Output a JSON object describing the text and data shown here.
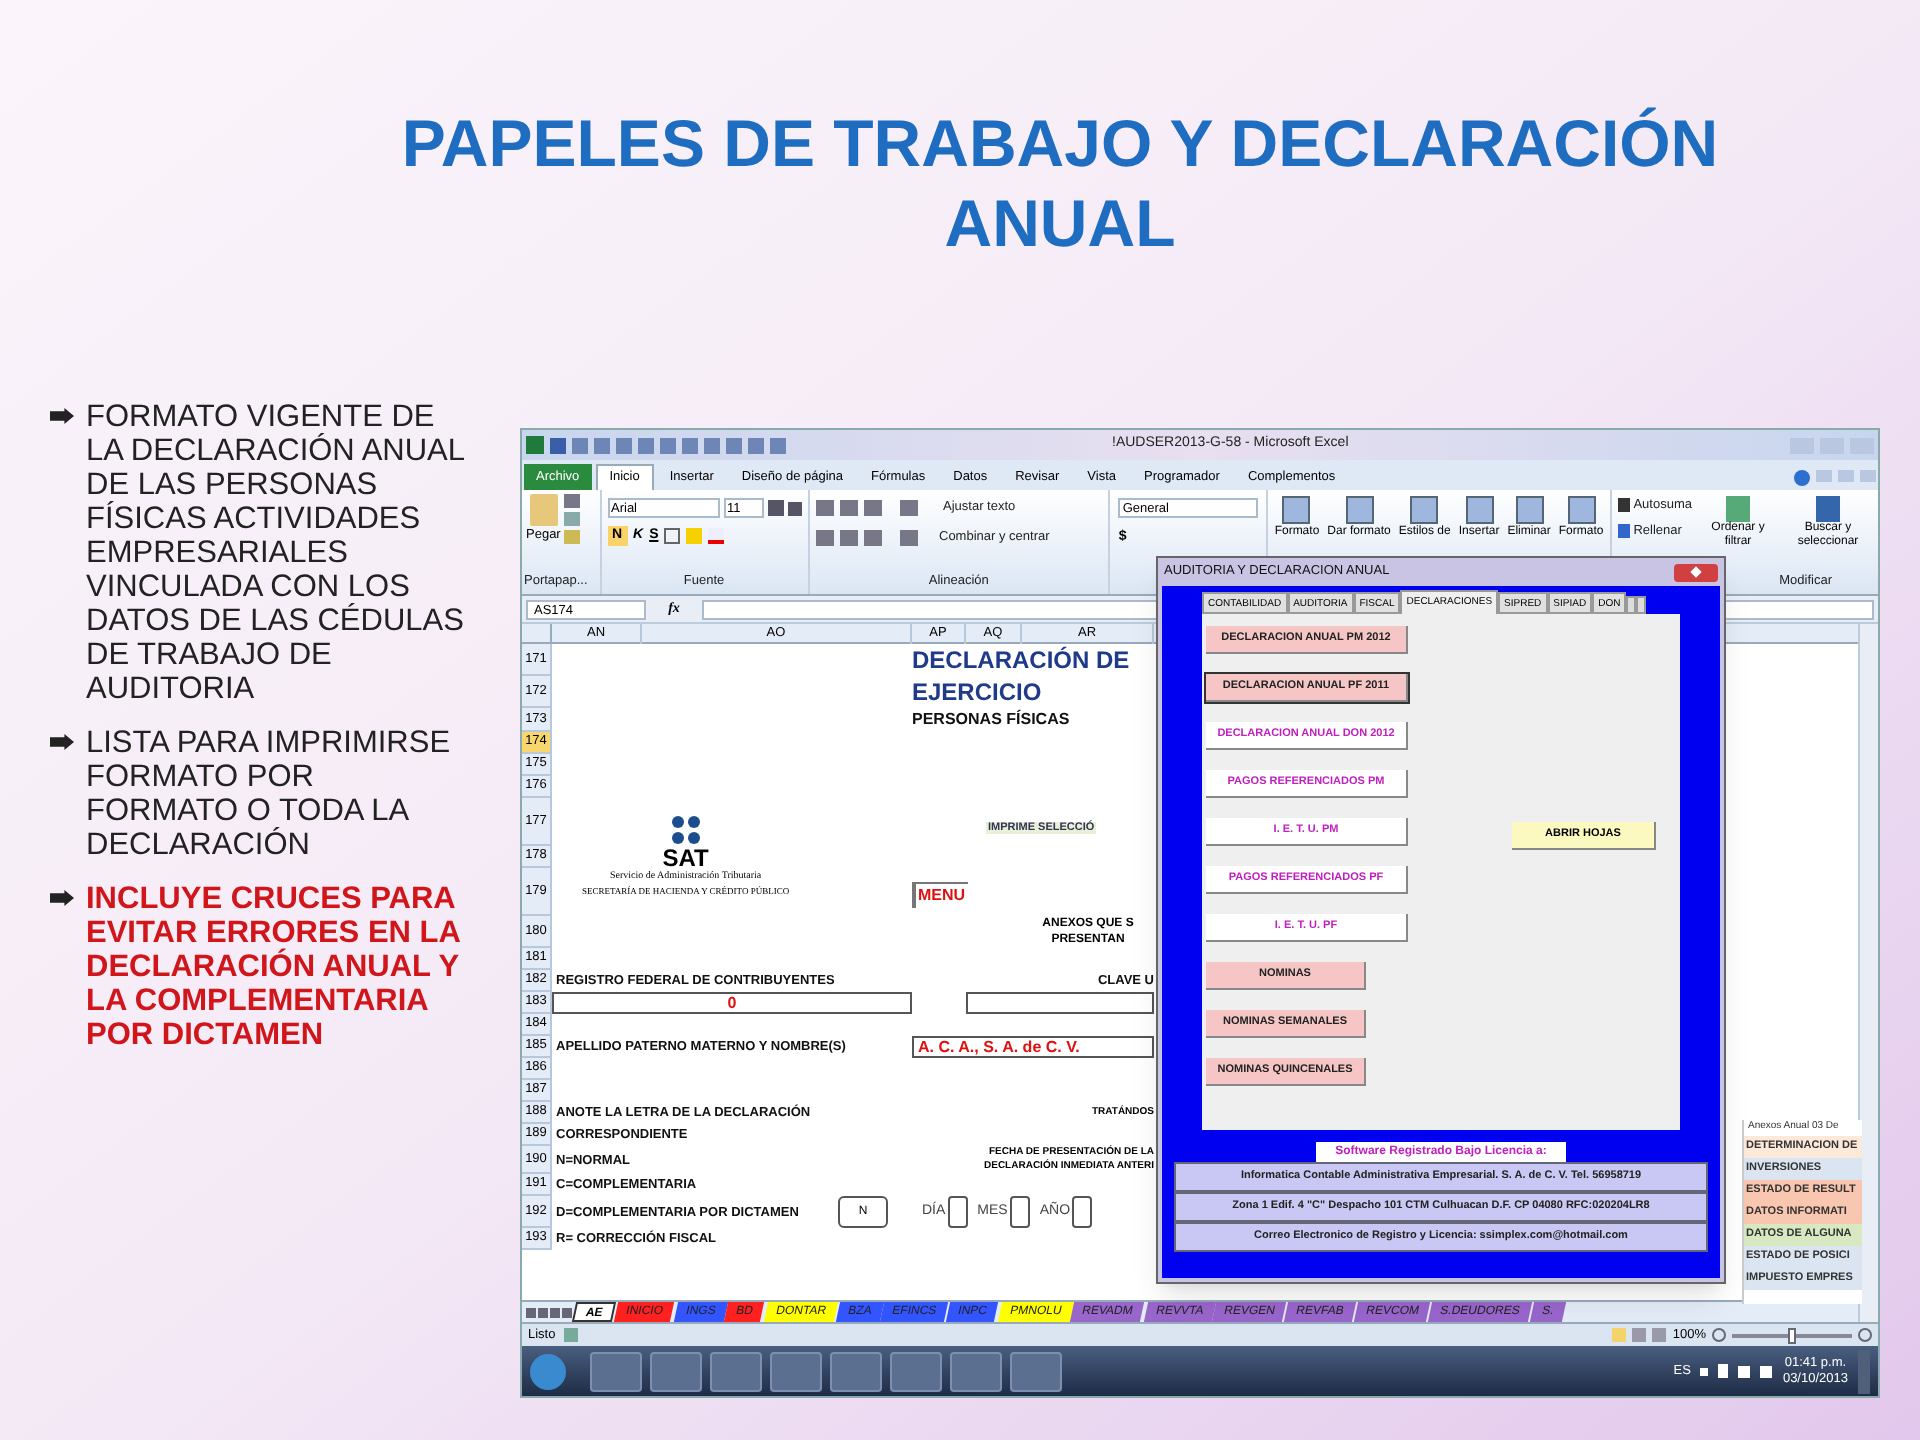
{
  "title": "PAPELES DE TRABAJO Y DECLARACIÓN ANUAL",
  "bullets": [
    {
      "text": "FORMATO VIGENTE DE LA DECLARACIÓN ANUAL DE LAS PERSONAS FÍSICAS ACTIVIDADES EMPRESARIALES VINCULADA CON LOS DATOS DE LAS CÉDULAS DE TRABAJO DE AUDITORIA",
      "emphasis": false
    },
    {
      "text": "LISTA PARA IMPRIMIRSE FORMATO POR FORMATO O TODA LA DECLARACIÓN",
      "emphasis": false
    },
    {
      "text": "INCLUYE CRUCES PARA EVITAR ERRORES EN LA DECLARACIÓN ANUAL Y LA COMPLEMENTARIA POR DICTAMEN",
      "emphasis": true
    }
  ],
  "excel": {
    "window_title": "!AUDSER2013-G-58 - Microsoft Excel",
    "ribbon_tabs": [
      {
        "label": "Archivo",
        "kind": "file",
        "selected": false
      },
      {
        "label": "Inicio",
        "kind": "tab",
        "selected": true
      },
      {
        "label": "Insertar",
        "kind": "tab",
        "selected": false
      },
      {
        "label": "Diseño de página",
        "kind": "tab",
        "selected": false
      },
      {
        "label": "Fórmulas",
        "kind": "tab",
        "selected": false
      },
      {
        "label": "Datos",
        "kind": "tab",
        "selected": false
      },
      {
        "label": "Revisar",
        "kind": "tab",
        "selected": false
      },
      {
        "label": "Vista",
        "kind": "tab",
        "selected": false
      },
      {
        "label": "Programador",
        "kind": "tab",
        "selected": false
      },
      {
        "label": "Complementos",
        "kind": "tab",
        "selected": false
      }
    ],
    "ribbon": {
      "paste": "Pegar",
      "clipboard_group": "Portapap...",
      "font_name": "Arial",
      "font_size": "11",
      "bold": "N",
      "italic": "K",
      "underline": "S",
      "font_group": "Fuente",
      "wrap_text": "Ajustar texto",
      "merge_center": "Combinar y centrar",
      "alignment_group": "Alineación",
      "number_format": "General",
      "currency": "$",
      "style_buttons": [
        "Formato",
        "Dar formato",
        "Estilos de"
      ],
      "cell_buttons": [
        "Insertar",
        "Eliminar",
        "Formato"
      ],
      "autosum": "Autosuma",
      "fill": "Rellenar",
      "sort": "Ordenar y filtrar",
      "find": "Buscar y seleccionar",
      "editing_group": "Modificar"
    },
    "name_box": "AS174",
    "formula_label": "fx",
    "columns": [
      "AN",
      "AO",
      "AP",
      "AQ",
      "AR"
    ],
    "rows": [
      {
        "number": "171",
        "selected": false,
        "right": {
          "kind": "title",
          "text": "DECLARACIÓN DE"
        }
      },
      {
        "number": "172",
        "selected": false,
        "right": {
          "kind": "title",
          "text": "EJERCICIO"
        }
      },
      {
        "number": "173",
        "selected": false,
        "right": {
          "kind": "subtitle",
          "text": "PERSONAS FÍSICAS"
        }
      },
      {
        "number": "174",
        "selected": true
      },
      {
        "number": "175",
        "selected": false
      },
      {
        "number": "176",
        "selected": false
      },
      {
        "number": "177",
        "selected": false,
        "far": {
          "kind": "note",
          "text": "IMPRIME SELECCIÓ"
        }
      },
      {
        "number": "178",
        "selected": false,
        "middle": {
          "kind": "logo",
          "text": "SAT",
          "lines": [
            "Servicio de Administración Tributaria",
            "SECRETARÍA DE HACIENDA Y CRÉDITO PÚBLICO"
          ]
        }
      },
      {
        "number": "179",
        "selected": false,
        "right": {
          "kind": "menu",
          "text": "MENU"
        }
      },
      {
        "number": "180",
        "selected": false,
        "far": {
          "kind": "label",
          "lines": [
            "ANEXOS QUE S",
            "PRESENTAN"
          ]
        }
      },
      {
        "number": "181",
        "selected": false
      },
      {
        "number": "182",
        "selected": false,
        "left": {
          "kind": "label",
          "text": "REGISTRO FEDERAL DE CONTRIBUYENTES"
        },
        "far": {
          "kind": "label",
          "text": "CLAVE U"
        }
      },
      {
        "number": "183",
        "selected": false,
        "left": {
          "kind": "input",
          "text": "0"
        },
        "far": {
          "kind": "input"
        }
      },
      {
        "number": "184",
        "selected": false
      },
      {
        "number": "185",
        "selected": false,
        "left": {
          "kind": "label",
          "text": "APELLIDO PATERNO MATERNO Y NOMBRE(S)"
        },
        "right": {
          "kind": "input",
          "text": "A. C. A.,  S. A. de C. V."
        }
      },
      {
        "number": "186",
        "selected": false
      },
      {
        "number": "187",
        "selected": false
      },
      {
        "number": "188",
        "selected": false,
        "left": {
          "kind": "label",
          "text": "ANOTE LA LETRA DE LA DECLARACIÓN"
        },
        "far": {
          "kind": "small",
          "text": "TRATÁNDOS"
        }
      },
      {
        "number": "189",
        "selected": false,
        "left": {
          "kind": "label",
          "text": "CORRESPONDIENTE"
        }
      },
      {
        "number": "190",
        "selected": false,
        "left": {
          "kind": "label",
          "text": "N=NORMAL"
        },
        "right": {
          "kind": "small",
          "lines": [
            "FECHA DE PRESENTACIÓN DE LA",
            "DECLARACIÓN INMEDIATA ANTERI"
          ]
        }
      },
      {
        "number": "191",
        "selected": false,
        "left": {
          "kind": "label",
          "text": "C=COMPLEMENTARIA"
        }
      },
      {
        "number": "192",
        "selected": false,
        "left": {
          "kind": "label",
          "text": "D=COMPLEMENTARIA POR DICTAMEN"
        },
        "middle": {
          "kind": "letter",
          "text": "N"
        },
        "right": {
          "kind": "date",
          "lines": [
            "DÍA",
            "MES",
            "AÑO"
          ]
        }
      },
      {
        "number": "193",
        "selected": false,
        "left": {
          "kind": "label",
          "text": "R= CORRECCIÓN FISCAL"
        }
      }
    ],
    "sheet_tabs": [
      {
        "label": "AE",
        "selected": true,
        "color": "#ffffff"
      },
      {
        "label": "INICIO",
        "selected": false,
        "color": "#ff2020"
      },
      {
        "label": "INGS",
        "selected": false,
        "color": "#3355ff"
      },
      {
        "label": "BD",
        "selected": false,
        "color": "#ff2020"
      },
      {
        "label": "DONTAR",
        "selected": false,
        "color": "#ffff00"
      },
      {
        "label": "BZA",
        "selected": false,
        "color": "#3355ff"
      },
      {
        "label": "EFINCS",
        "selected": false,
        "color": "#3355ff"
      },
      {
        "label": "INPC",
        "selected": false,
        "color": "#3355ff"
      },
      {
        "label": "PMNOLU",
        "selected": false,
        "color": "#ffff00"
      },
      {
        "label": "REVADM",
        "selected": false,
        "color": "#9966cc"
      },
      {
        "label": "REVVTA",
        "selected": false,
        "color": "#9966cc"
      },
      {
        "label": "REVGEN",
        "selected": false,
        "color": "#9966cc"
      },
      {
        "label": "REVFAB",
        "selected": false,
        "color": "#9966cc"
      },
      {
        "label": "REVCOM",
        "selected": false,
        "color": "#9966cc"
      },
      {
        "label": "S.DEUDORES",
        "selected": false,
        "color": "#9966cc"
      },
      {
        "label": "S.",
        "selected": false,
        "color": "#9966cc"
      }
    ],
    "status": "Listo",
    "zoom": "100%",
    "zoom_slider": {
      "level": 0.5
    },
    "annex_panel": {
      "title": "Anexos Anual 03 De",
      "items": [
        {
          "label": "DETERMINACION DE",
          "color": "#fde9d9"
        },
        {
          "label": "INVERSIONES",
          "color": "#dbe5f1"
        },
        {
          "label": "ESTADO DE RESULT",
          "color": "#f9c7b0"
        },
        {
          "label": "DATOS INFORMATI",
          "color": "#f9c7b0"
        },
        {
          "label": "DATOS DE ALGUNA",
          "color": "#d8e8c0"
        },
        {
          "label": "ESTADO DE POSICI",
          "color": "#dbe5f1"
        },
        {
          "label": "IMPUESTO EMPRES",
          "color": "#dbe5f1"
        }
      ]
    },
    "dialog": {
      "title": "AUDITORIA Y DECLARACION ANUAL",
      "tabs": [
        {
          "label": "CONTABILIDAD",
          "selected": false
        },
        {
          "label": "AUDITORIA",
          "selected": false
        },
        {
          "label": "FISCAL",
          "selected": false
        },
        {
          "label": "DECLARACIONES",
          "selected": true
        },
        {
          "label": "SIPRED",
          "selected": false
        },
        {
          "label": "SIPIAD",
          "selected": false
        },
        {
          "label": "DON",
          "selected": false
        }
      ],
      "buttons": [
        {
          "label": "DECLARACION ANUAL PM 2012",
          "kind": "highlighted",
          "focused": false
        },
        {
          "label": "DECLARACION ANUAL PF 2011",
          "kind": "highlighted",
          "focused": true
        },
        {
          "label": "DECLARACION ANUAL DON 2012",
          "kind": "plain",
          "focused": false
        },
        {
          "label": "PAGOS REFERENCIADOS PM",
          "kind": "plain",
          "focused": false
        },
        {
          "label": "I. E. T. U.   PM",
          "kind": "plain",
          "focused": false
        },
        {
          "label": "PAGOS REFERENCIADOS PF",
          "kind": "plain",
          "focused": false
        },
        {
          "label": "I. E. T. U.  PF",
          "kind": "plain",
          "focused": false
        }
      ],
      "payroll_buttons": [
        {
          "label": "NOMINAS",
          "kind": "highlighted",
          "focused": false
        },
        {
          "label": "NOMINAS SEMANALES",
          "kind": "highlighted",
          "focused": false
        },
        {
          "label": "NOMINAS QUINCENALES",
          "kind": "highlighted",
          "focused": false
        }
      ],
      "open_button": "ABRIR HOJAS",
      "license_heading": "Software Registrado Bajo Licencia a:",
      "license_lines": [
        "Informatica Contable Administrativa Empresarial. S. A. de C. V. Tel. 56958719",
        "Zona 1 Edif. 4 \"C\" Despacho 101 CTM Culhuacan D.F. CP 04080 RFC:020204LR8",
        "Correo Electronico de Registro y Licencia: ssimplex.com@hotmail.com"
      ]
    }
  },
  "taskbar": {
    "language": "ES",
    "time": "01:41 p.m.",
    "date": "03/10/2013"
  }
}
